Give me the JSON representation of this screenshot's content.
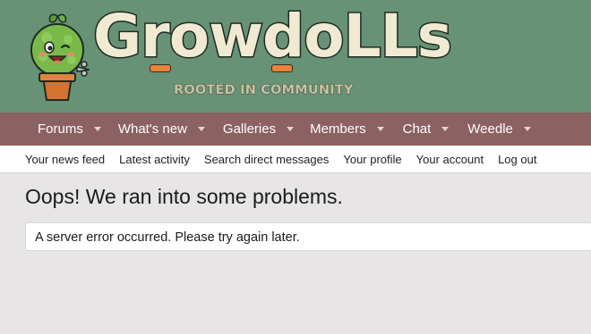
{
  "header": {
    "logo_icon": "potted-plant-mascot-icon",
    "logo_text": "GrowdoLLs",
    "tagline": "ROOTED IN COMMUNITY",
    "colors": {
      "header_bg": "#679275",
      "wordmark_fill": "#f1ead3",
      "accent": "#e8823b"
    }
  },
  "nav": {
    "tabs": [
      {
        "label": "Forums"
      },
      {
        "label": "What's new"
      },
      {
        "label": "Galleries"
      },
      {
        "label": "Members"
      },
      {
        "label": "Chat"
      },
      {
        "label": "Weedle"
      }
    ],
    "caret_icon": "chevron-down-icon",
    "colors": {
      "bg": "#8b6161"
    }
  },
  "subnav": {
    "links": [
      {
        "label": "Your news feed"
      },
      {
        "label": "Latest activity"
      },
      {
        "label": "Search direct messages"
      },
      {
        "label": "Your profile"
      },
      {
        "label": "Your account"
      },
      {
        "label": "Log out"
      }
    ]
  },
  "main": {
    "title": "Oops! We ran into some problems.",
    "error_message": "A server error occurred. Please try again later."
  }
}
